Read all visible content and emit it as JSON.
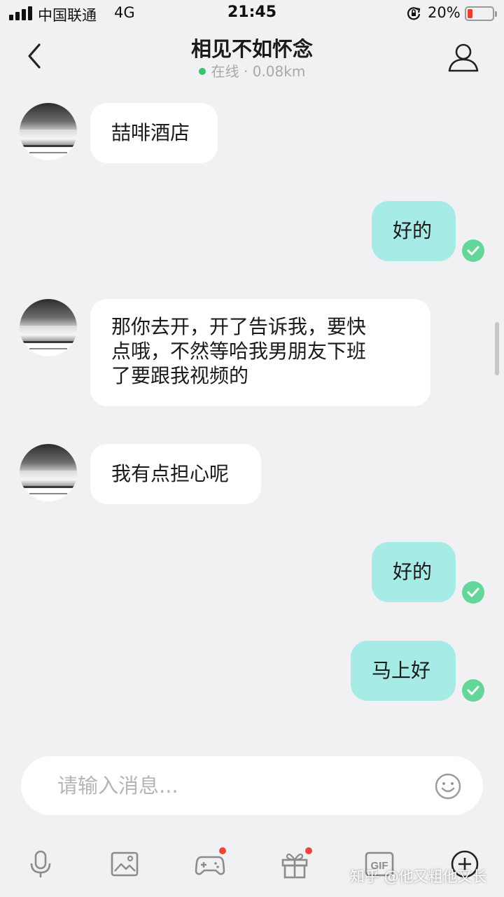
{
  "status_bar": {
    "carrier": "中国联通",
    "network": "4G",
    "time": "21:45",
    "battery_percent": "20%",
    "battery_level": 0.2,
    "icons": [
      "signal-icon",
      "rotation-lock-icon",
      "battery-icon"
    ]
  },
  "header": {
    "title": "相见不如怀念",
    "status_text": "在线 · 0.08km",
    "online_color": "#33c46f",
    "icons": [
      "back-arrow-icon",
      "profile-icon"
    ]
  },
  "messages": [
    {
      "direction": "incoming",
      "text": "喆啡酒店"
    },
    {
      "direction": "outgoing",
      "text": "好的",
      "read": true
    },
    {
      "direction": "incoming",
      "lines": [
        "那你去开，开了告诉我，要快",
        "点哦，不然等哈我男朋友下班",
        "了要跟我视频的"
      ]
    },
    {
      "direction": "incoming",
      "text": "我有点担心呢"
    },
    {
      "direction": "outgoing",
      "text": "好的",
      "read": true
    },
    {
      "direction": "outgoing",
      "text": "马上好",
      "read": true
    }
  ],
  "colors": {
    "background": "#f1f1f3",
    "incoming_bubble": "#ffffff",
    "outgoing_bubble": "#a6ebe6",
    "read_check": "#64d69a",
    "badge": "#f0433a"
  },
  "input": {
    "placeholder": "请输入消息...",
    "value": ""
  },
  "toolbar": {
    "items": [
      {
        "icon": "microphone-icon",
        "badge": false
      },
      {
        "icon": "image-icon",
        "badge": false
      },
      {
        "icon": "game-controller-icon",
        "badge": true
      },
      {
        "icon": "gift-icon",
        "badge": true
      },
      {
        "icon": "gif-icon",
        "badge": false,
        "label": "GIF"
      },
      {
        "icon": "plus-circle-icon",
        "badge": false
      }
    ]
  },
  "watermark": "知乎 @他又粗他又长"
}
